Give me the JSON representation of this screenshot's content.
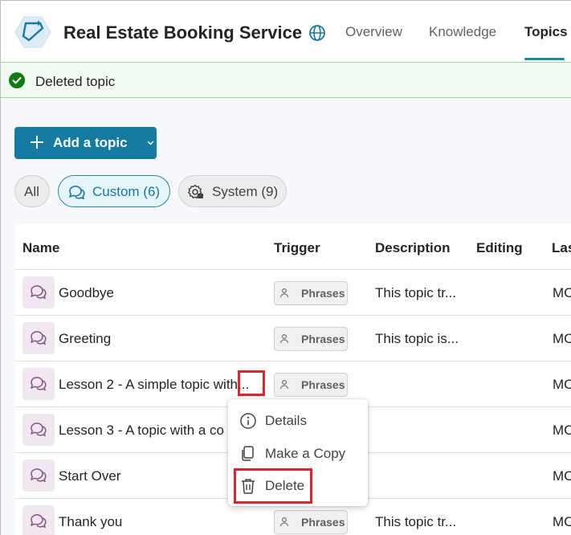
{
  "header": {
    "bot_name": "Real Estate Booking Service",
    "tabs": [
      {
        "label": "Overview",
        "active": false
      },
      {
        "label": "Knowledge",
        "active": false
      },
      {
        "label": "Topics",
        "active": true
      }
    ]
  },
  "banner": {
    "message": "Deleted topic",
    "status_color": "#107c10"
  },
  "toolbar": {
    "add_topic_label": "Add a topic"
  },
  "filters": [
    {
      "label": "All",
      "active": false
    },
    {
      "label": "Custom (6)",
      "active": true
    },
    {
      "label": "System (9)",
      "active": false
    }
  ],
  "table": {
    "columns": [
      "Name",
      "Trigger",
      "Description",
      "Editing",
      "Las"
    ],
    "rows": [
      {
        "name": "Goodbye",
        "trigger": "Phrases",
        "description": "This topic tr...",
        "last": "MC"
      },
      {
        "name": "Greeting",
        "trigger": "Phrases",
        "description": "This topic is...",
        "last": "MC"
      },
      {
        "name": "Lesson 2 - A simple topic with...",
        "trigger": "Phrases",
        "description": "",
        "last": "MC"
      },
      {
        "name": "Lesson 3 - A topic with a co",
        "trigger": "",
        "description": "",
        "last": "MC"
      },
      {
        "name": "Start Over",
        "trigger": "",
        "description": "",
        "last": "MC"
      },
      {
        "name": "Thank you",
        "trigger": "Phrases",
        "description": "This topic tr...",
        "last": "MC"
      }
    ]
  },
  "context_menu": {
    "items": [
      {
        "label": "Details",
        "icon": "info-icon"
      },
      {
        "label": "Make a Copy",
        "icon": "copy-icon"
      },
      {
        "label": "Delete",
        "icon": "trash-icon"
      }
    ]
  },
  "colors": {
    "accent": "#147ba3",
    "highlight": "#e8202a",
    "topic_icon_bg": "#f1e7f1",
    "topic_icon_stroke": "#8a5a8a"
  }
}
